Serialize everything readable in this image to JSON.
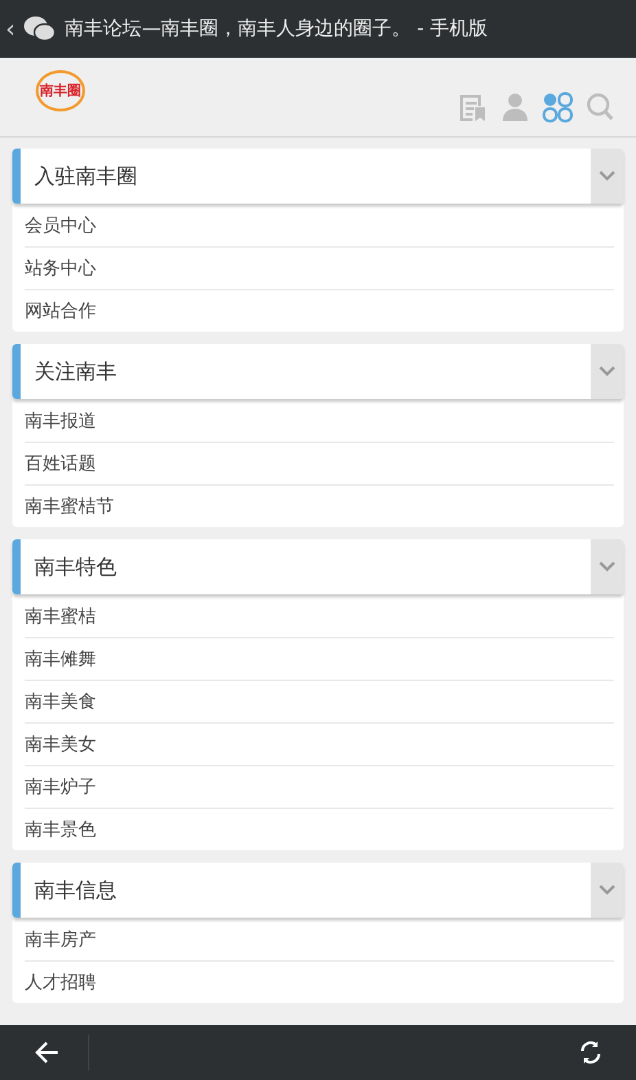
{
  "top_bar": {
    "back": "‹",
    "title": "南丰论坛—南丰圈，南丰人身边的圈子。 - 手机版"
  },
  "header": {
    "logo": "南丰圈",
    "tools": [
      {
        "kind": "threads",
        "selected": false
      },
      {
        "kind": "user",
        "selected": false
      },
      {
        "kind": "apps",
        "selected": true
      },
      {
        "kind": "search",
        "selected": false
      }
    ]
  },
  "sections": [
    {
      "title": "入驻南丰圈",
      "expanded": true,
      "items": [
        "会员中心",
        "站务中心",
        "网站合作"
      ]
    },
    {
      "title": "关注南丰",
      "expanded": true,
      "items": [
        "南丰报道",
        "百姓话题",
        "南丰蜜桔节"
      ]
    },
    {
      "title": "南丰特色",
      "expanded": true,
      "items": [
        "南丰蜜桔",
        "南丰傩舞",
        "南丰美食",
        "南丰美女",
        "南丰炉子",
        "南丰景色"
      ]
    },
    {
      "title": "南丰信息",
      "expanded": true,
      "items": [
        "南丰房产",
        "人才招聘"
      ]
    }
  ]
}
